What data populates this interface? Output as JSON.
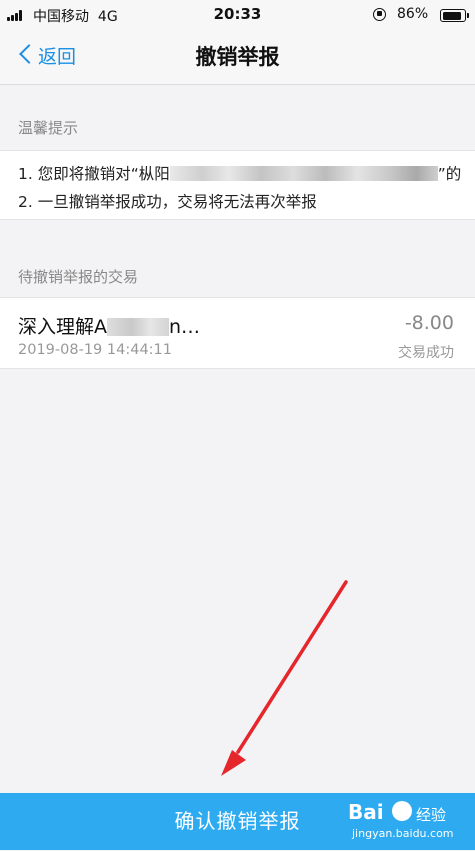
{
  "status_bar": {
    "carrier": "中国移动",
    "network": "4G",
    "time": "20:33",
    "battery_percent": "86%",
    "battery_level": 0.86
  },
  "nav": {
    "back_label": "返回",
    "title": "撤销举报"
  },
  "tips": {
    "header": "温馨提示",
    "line1_prefix": "1. 您即将撤销对“枞阳",
    "line1_suffix": "”的",
    "line2": "2. 一旦撤销举报成功，交易将无法再次举报"
  },
  "transactions": {
    "header": "待撤销举报的交易",
    "items": [
      {
        "name_prefix": "深入理解A",
        "name_suffix": "n…",
        "date": "2019-08-19 14:44:11",
        "amount": "-8.00",
        "status": "交易成功"
      }
    ]
  },
  "confirm_button": {
    "label": "确认撤销举报"
  },
  "watermark": {
    "brand": "Bai",
    "brand_suffix": "经验",
    "url": "jingyan.baidu.com"
  },
  "colors": {
    "accent": "#1a8fe6",
    "button": "#2eaaf0",
    "annotation_arrow": "#e5262b"
  }
}
